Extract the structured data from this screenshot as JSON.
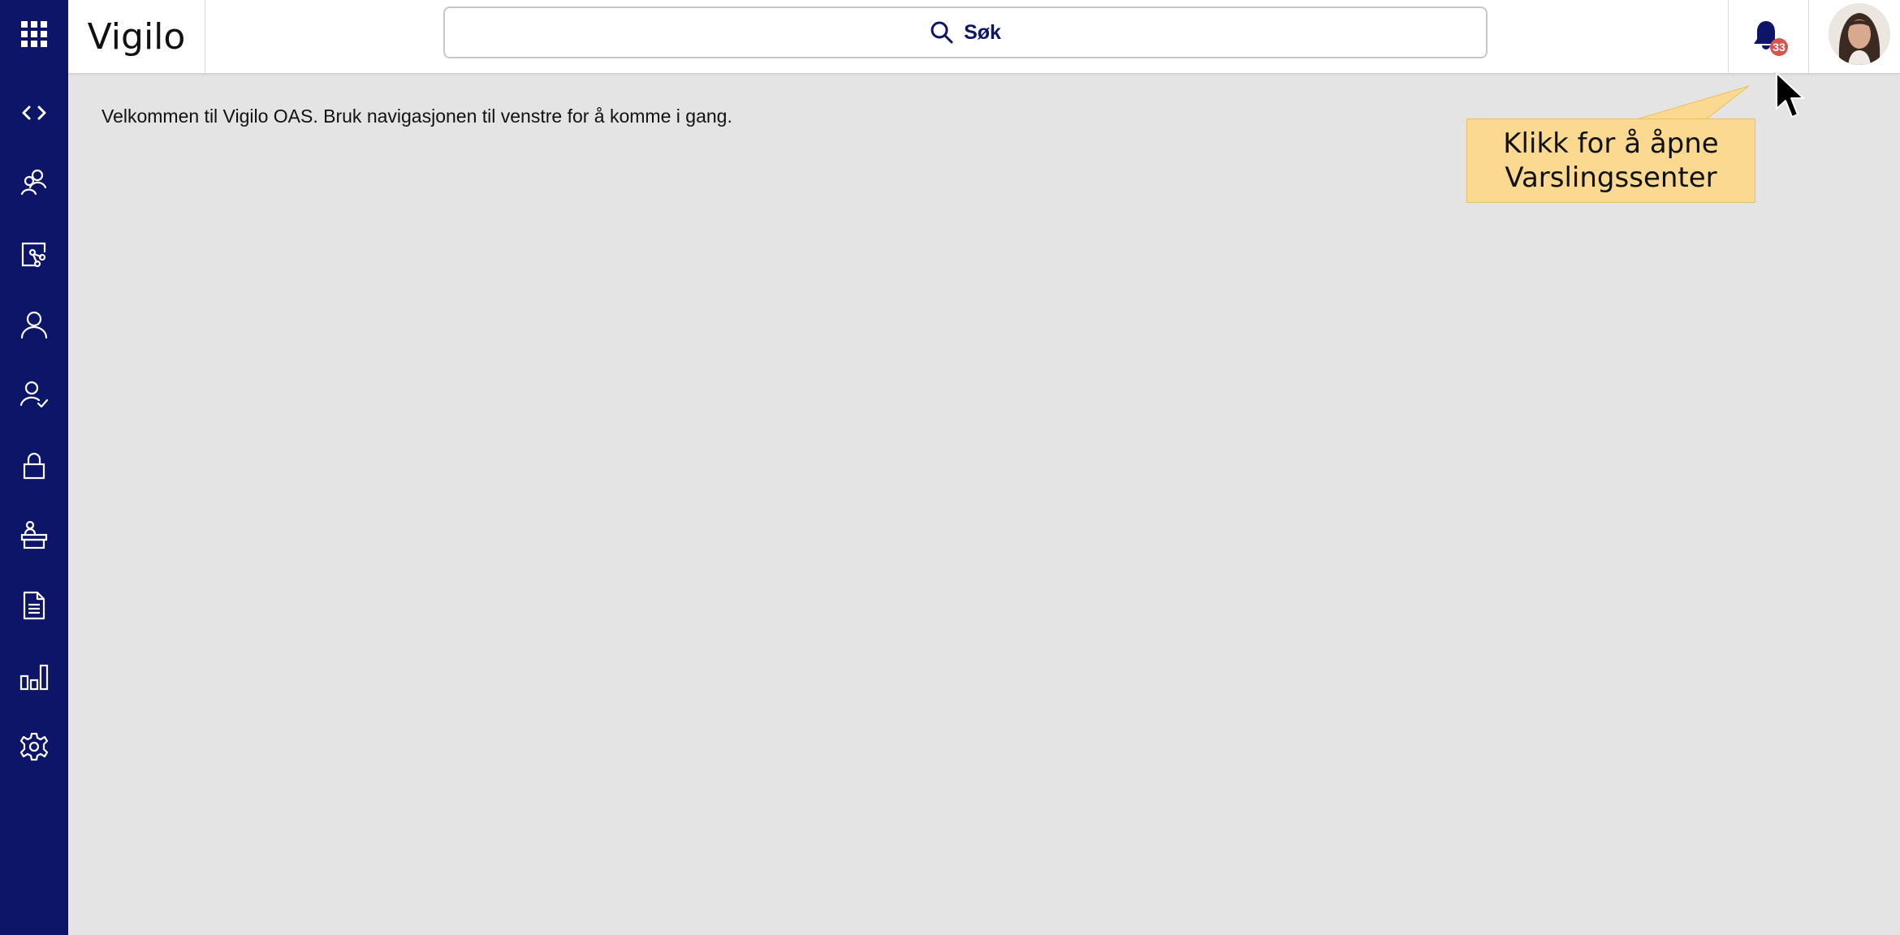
{
  "app": {
    "title": "Vigilo"
  },
  "header": {
    "search_label": "Søk",
    "notification_count": "33"
  },
  "sidebar": {
    "items": [
      {
        "icon": "code-icon"
      },
      {
        "icon": "users-group-icon"
      },
      {
        "icon": "org-chart-icon"
      },
      {
        "icon": "user-icon"
      },
      {
        "icon": "user-check-icon"
      },
      {
        "icon": "lock-icon"
      },
      {
        "icon": "desk-person-icon"
      },
      {
        "icon": "document-icon"
      },
      {
        "icon": "bar-chart-icon"
      },
      {
        "icon": "gear-icon"
      }
    ]
  },
  "main": {
    "welcome_text": "Velkommen til Vigilo OAS. Bruk navigasjonen til venstre for å komme i gang."
  },
  "tooltip": {
    "text_line1": "Klikk for å åpne",
    "text_line2": "Varslingssenter"
  },
  "colors": {
    "sidebar": "#0c1567",
    "tooltip": "#fcd991",
    "badge": "#d9534f",
    "background": "#e4e4e4"
  }
}
